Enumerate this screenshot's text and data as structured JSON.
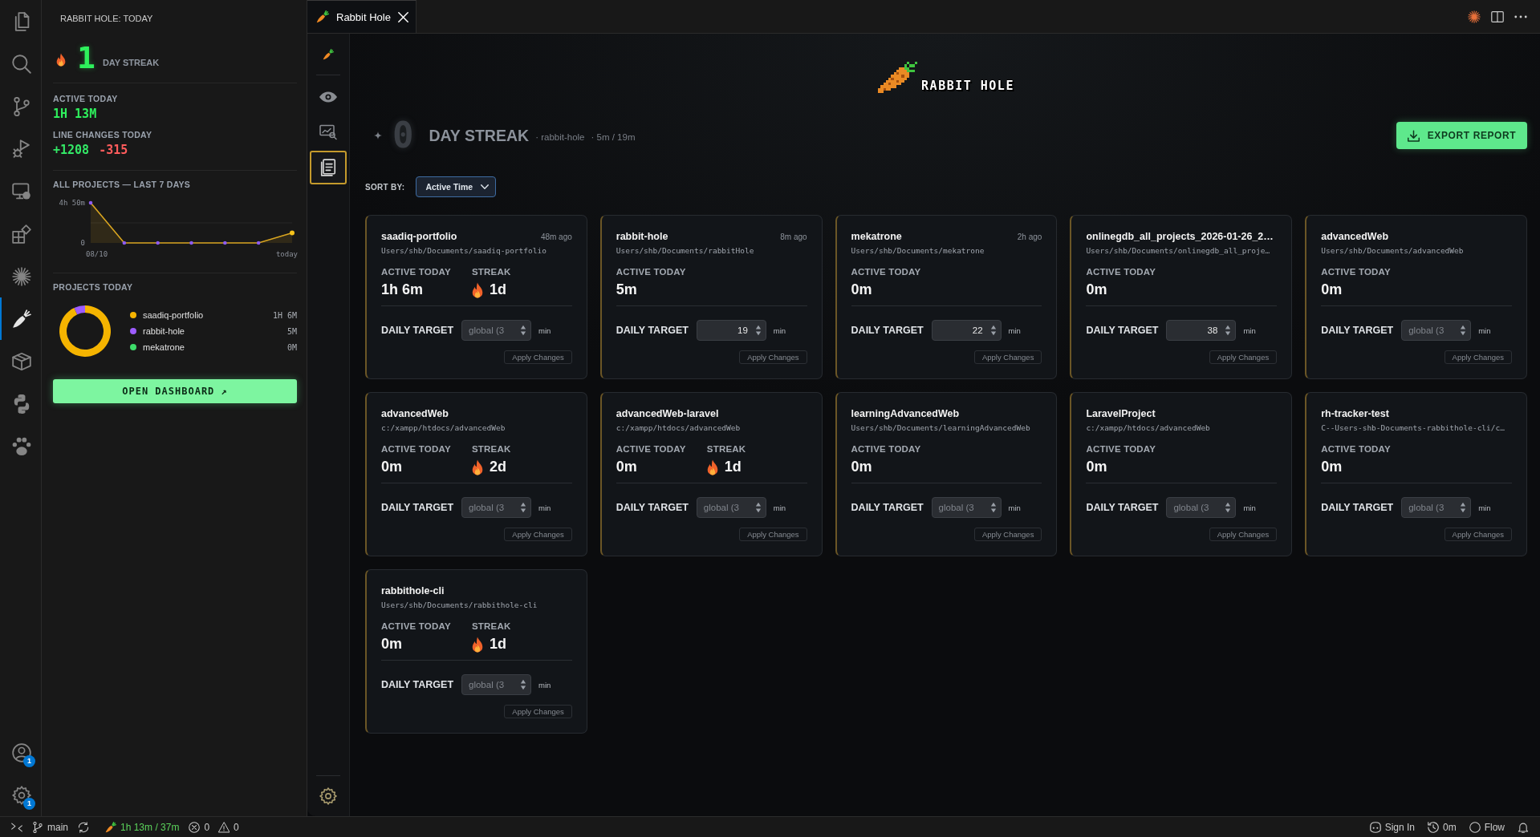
{
  "activity_bar": {
    "items": [
      {
        "kind": "files",
        "selected": false
      },
      {
        "kind": "search",
        "selected": false
      },
      {
        "kind": "source-control",
        "selected": false
      },
      {
        "kind": "run-debug",
        "selected": false
      },
      {
        "kind": "remote",
        "selected": false
      },
      {
        "kind": "extensions",
        "selected": false
      },
      {
        "kind": "sparkle",
        "selected": false
      },
      {
        "kind": "carrot",
        "selected": true
      },
      {
        "kind": "package",
        "selected": false
      },
      {
        "kind": "python",
        "selected": false
      },
      {
        "kind": "paw",
        "selected": false
      }
    ],
    "bottom": [
      {
        "kind": "account",
        "badge": "1"
      },
      {
        "kind": "settings",
        "badge": "1"
      }
    ]
  },
  "sidebar": {
    "title": "RABBIT HOLE: TODAY",
    "streak": {
      "count": "1",
      "label": "DAY STREAK"
    },
    "active_today": {
      "label": "ACTIVE TODAY",
      "value": "1H 13M"
    },
    "line_changes": {
      "label": "LINE CHANGES TODAY",
      "added": "+1208",
      "removed": "-315"
    },
    "weekly": {
      "title": "ALL PROJECTS — LAST 7 DAYS",
      "y_labels": [
        "4h 50m",
        "0"
      ],
      "x_labels": [
        "08/10",
        "today"
      ]
    },
    "projects_today": {
      "title": "PROJECTS TODAY",
      "chart_data": {
        "type": "donut",
        "categories": [
          "saadiq-portfolio",
          "rabbit-hole",
          "mekatrone"
        ],
        "values": [
          93,
          7,
          0
        ]
      },
      "legend": [
        {
          "time": "1H 6M",
          "color": "#f5b400"
        },
        {
          "time": "5M",
          "color": "#9d5cff"
        },
        {
          "time": "0M",
          "color": "#3ddc6a"
        }
      ]
    },
    "dashboard_button": {
      "label": "OPEN DASHBOARD ↗"
    }
  },
  "tabs": [
    {
      "label": "Rabbit Hole",
      "selected": true
    }
  ],
  "rail": {
    "items": [
      {
        "kind": "carrot",
        "selected": false
      },
      {
        "kind": "eye",
        "selected": false
      },
      {
        "kind": "report",
        "selected": false
      },
      {
        "kind": "notes",
        "selected": true
      }
    ]
  },
  "logo": {
    "text": "RABBIT HOLE"
  },
  "streak_header": {
    "count": "0",
    "label": "DAY STREAK",
    "project": "· rabbit-hole",
    "progress": "· 5m / 19m"
  },
  "export_button": {
    "label": "EXPORT REPORT"
  },
  "sort": {
    "label": "SORT BY:",
    "value": "Active Time"
  },
  "projects": [
    {
      "name": "saadiq-portfolio",
      "ago": "48m ago",
      "path": "Users/shb/Documents/saadiq-portfolio",
      "active_label": "ACTIVE TODAY",
      "active": "1h 6m",
      "streak_label": "STREAK",
      "streak": "1d",
      "target_label": "DAILY TARGET",
      "placeholder": "global (3",
      "unit": "min",
      "apply": {
        "label": "Apply Changes",
        "disabled": true
      }
    },
    {
      "name": "rabbit-hole",
      "ago": "8m ago",
      "path": "Users/shb/Documents/rabbitHole",
      "active_label": "ACTIVE TODAY",
      "active": "5m",
      "target_label": "DAILY TARGET",
      "value": "19",
      "unit": "min",
      "apply": {
        "label": "Apply Changes",
        "disabled": true
      }
    },
    {
      "name": "mekatrone",
      "ago": "2h ago",
      "path": "Users/shb/Documents/mekatrone",
      "active_label": "ACTIVE TODAY",
      "active": "0m",
      "target_label": "DAILY TARGET",
      "value": "22",
      "unit": "min",
      "apply": {
        "label": "Apply Changes",
        "disabled": true
      }
    },
    {
      "name": "onlinegdb_all_projects_2026-01-26_2…",
      "path": "Users/shb/Documents/onlinegdb_all_proje…",
      "active_label": "ACTIVE TODAY",
      "active": "0m",
      "target_label": "DAILY TARGET",
      "value": "38",
      "unit": "min",
      "apply": {
        "label": "Apply Changes",
        "disabled": true
      }
    },
    {
      "name": "advancedWeb",
      "path": "Users/shb/Documents/advancedWeb",
      "active_label": "ACTIVE TODAY",
      "active": "0m",
      "target_label": "DAILY TARGET",
      "placeholder": "global (3",
      "unit": "min",
      "apply": {
        "label": "Apply Changes",
        "disabled": true
      }
    },
    {
      "name": "advancedWeb",
      "path": "c:/xampp/htdocs/advancedWeb",
      "active_label": "ACTIVE TODAY",
      "active": "0m",
      "streak_label": "STREAK",
      "streak": "2d",
      "target_label": "DAILY TARGET",
      "placeholder": "global (3",
      "unit": "min",
      "apply": {
        "label": "Apply Changes",
        "disabled": true
      }
    },
    {
      "name": "advancedWeb-laravel",
      "path": "c:/xampp/htdocs/advancedWeb",
      "active_label": "ACTIVE TODAY",
      "active": "0m",
      "streak_label": "STREAK",
      "streak": "1d",
      "target_label": "DAILY TARGET",
      "placeholder": "global (3",
      "unit": "min",
      "apply": {
        "label": "Apply Changes",
        "disabled": true
      }
    },
    {
      "name": "learningAdvancedWeb",
      "path": "Users/shb/Documents/learningAdvancedWeb",
      "active_label": "ACTIVE TODAY",
      "active": "0m",
      "target_label": "DAILY TARGET",
      "placeholder": "global (3",
      "unit": "min",
      "apply": {
        "label": "Apply Changes",
        "disabled": true
      }
    },
    {
      "name": "LaravelProject",
      "path": "c:/xampp/htdocs/advancedWeb",
      "active_label": "ACTIVE TODAY",
      "active": "0m",
      "target_label": "DAILY TARGET",
      "placeholder": "global (3",
      "unit": "min",
      "apply": {
        "label": "Apply Changes",
        "disabled": true
      }
    },
    {
      "name": "rh-tracker-test",
      "path": "C--Users-shb-Documents-rabbithole-cli/c…",
      "active_label": "ACTIVE TODAY",
      "active": "0m",
      "target_label": "DAILY TARGET",
      "placeholder": "global (3",
      "unit": "min",
      "apply": {
        "label": "Apply Changes",
        "disabled": true
      }
    },
    {
      "name": "rabbithole-cli",
      "path": "Users/shb/Documents/rabbithole-cli",
      "active_label": "ACTIVE TODAY",
      "active": "0m",
      "streak_label": "STREAK",
      "streak": "1d",
      "target_label": "DAILY TARGET",
      "placeholder": "global (3",
      "unit": "min",
      "apply": {
        "label": "Apply Changes",
        "disabled": true
      }
    }
  ],
  "status_bar": {
    "branch": "main",
    "tracker": "1h 13m / 37m",
    "errors": "0",
    "warnings": "0",
    "sign_in": "Sign In",
    "history": "0m",
    "flow": "Flow"
  }
}
